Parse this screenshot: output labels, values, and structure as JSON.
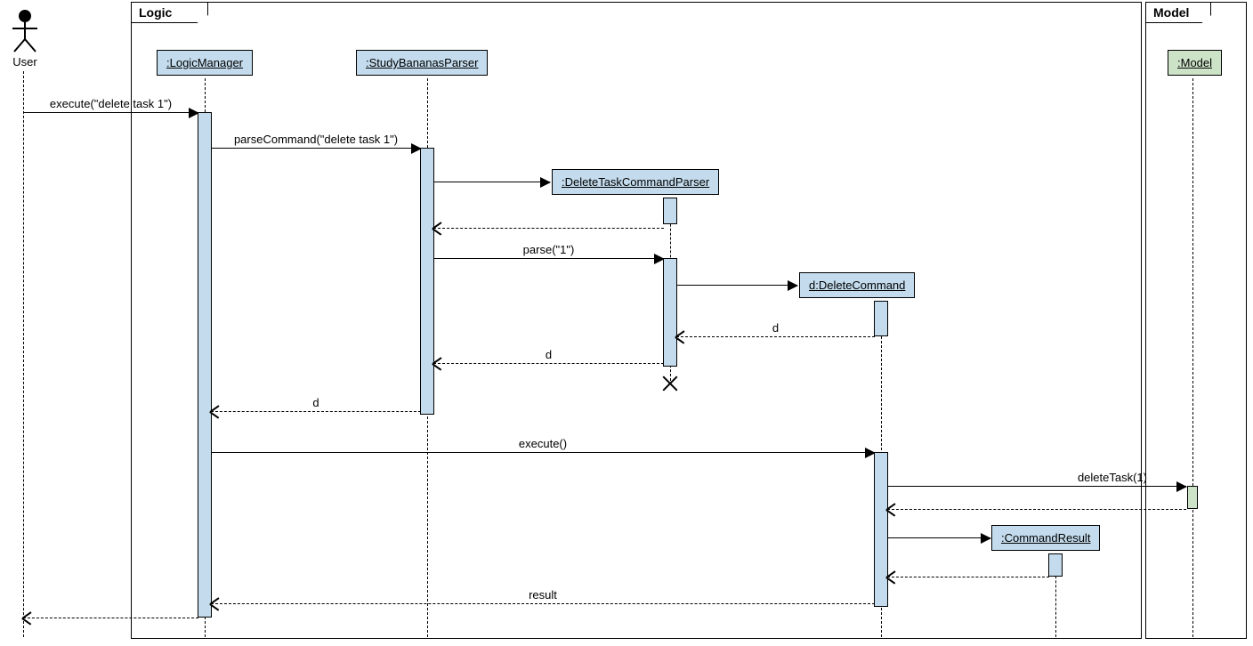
{
  "frames": {
    "logic": "Logic",
    "model": "Model"
  },
  "actor": {
    "label": "User"
  },
  "objects": {
    "logicManager": ":LogicManager",
    "parser": ":StudyBananasParser",
    "dtcParser": ":DeleteTaskCommandParser",
    "deleteCommand": "d:DeleteCommand",
    "commandResult": ":CommandResult",
    "model": ":Model"
  },
  "messages": {
    "execute": "execute(\"delete task 1\")",
    "parseCommand": "parseCommand(\"delete task 1\")",
    "parse1": "parse(\"1\")",
    "retD1": "d",
    "retD2": "d",
    "retD3": "d",
    "executeEmpty": "execute()",
    "deleteTask": "deleteTask(1)",
    "result": "result"
  }
}
